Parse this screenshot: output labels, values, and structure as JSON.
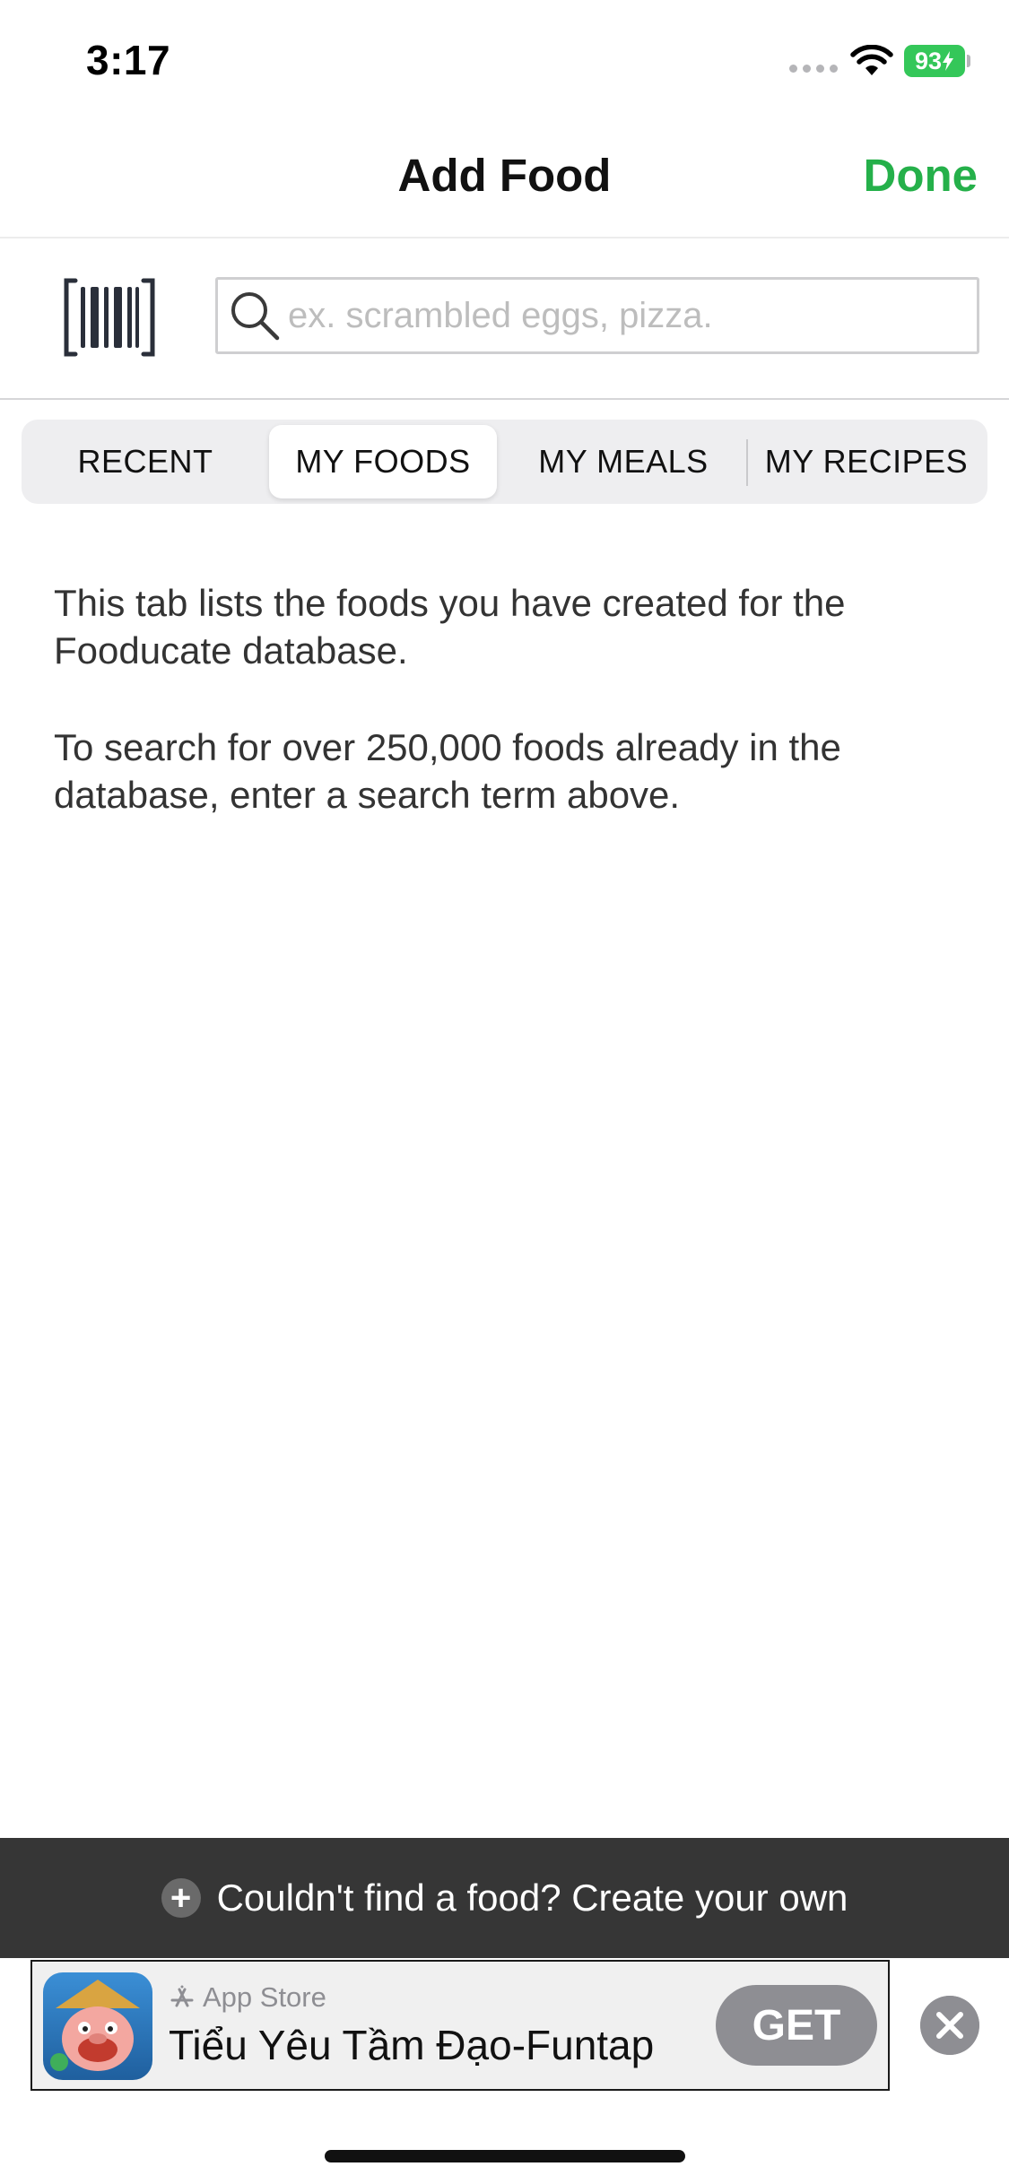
{
  "status_bar": {
    "time": "3:17",
    "battery": "93"
  },
  "nav": {
    "title": "Add Food",
    "done_label": "Done"
  },
  "search": {
    "placeholder": "ex. scrambled eggs, pizza."
  },
  "tabs": [
    {
      "label": "RECENT",
      "active": false
    },
    {
      "label": "MY FOODS",
      "active": true
    },
    {
      "label": "MY MEALS",
      "active": false
    },
    {
      "label": "MY RECIPES",
      "active": false
    }
  ],
  "content": {
    "paragraph1": "This tab lists the foods you have created for the Fooducate database.",
    "paragraph2": "To search for over 250,000 foods already in the database, enter a search term above."
  },
  "create_bar": {
    "label": "Couldn't find a food? Create your own"
  },
  "ad": {
    "store_label": "App Store",
    "title": "Tiểu Yêu Tầm Đạo-Funtap",
    "get_label": "GET"
  },
  "colors": {
    "accent": "#25b04a",
    "battery": "#34c759",
    "create_bar_bg": "#363636"
  }
}
